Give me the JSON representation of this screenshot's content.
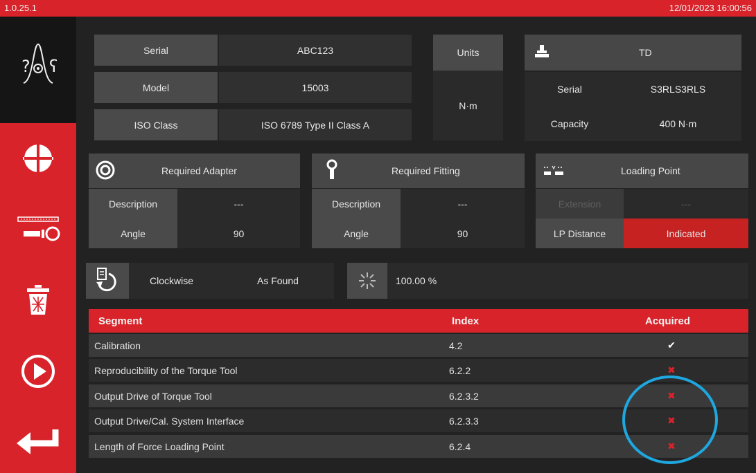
{
  "status_bar": {
    "version": "1.0.25.1",
    "datetime": "12/01/2023 16:00:56"
  },
  "device": {
    "serial_label": "Serial",
    "serial_value": "ABC123",
    "model_label": "Model",
    "model_value": "15003",
    "iso_label": "ISO Class",
    "iso_value": "ISO 6789 Type II Class A"
  },
  "units": {
    "label": "Units",
    "value": "N·m"
  },
  "transducer": {
    "title": "TD",
    "serial_label": "Serial",
    "serial_value": "S3RLS3RLS",
    "capacity_label": "Capacity",
    "capacity_value": "400 N·m"
  },
  "adapter": {
    "title": "Required Adapter",
    "desc_label": "Description",
    "desc_value": "---",
    "angle_label": "Angle",
    "angle_value": "90"
  },
  "fitting": {
    "title": "Required Fitting",
    "desc_label": "Description",
    "desc_value": "---",
    "angle_label": "Angle",
    "angle_value": "90"
  },
  "loading_point": {
    "title": "Loading Point",
    "extension_label": "Extension",
    "extension_value": "---",
    "lp_label": "LP Distance",
    "lp_value": "Indicated"
  },
  "direction": {
    "rotation": "Clockwise",
    "mode": "As Found"
  },
  "percent": {
    "value": "100.00 %"
  },
  "table": {
    "headers": [
      "Segment",
      "Index",
      "Acquired"
    ],
    "rows": [
      {
        "segment": "Calibration",
        "index": "4.2",
        "acquired": "✔"
      },
      {
        "segment": "Reproducibility of the Torque Tool",
        "index": "6.2.2",
        "acquired": "✖"
      },
      {
        "segment": "Output Drive of Torque Tool",
        "index": "6.2.3.2",
        "acquired": "✖"
      },
      {
        "segment": "Output Drive/Cal. System Interface",
        "index": "6.2.3.3",
        "acquired": "✖"
      },
      {
        "segment": "Length of Force Loading Point",
        "index": "6.2.4",
        "acquired": "✖"
      }
    ]
  },
  "colors": {
    "brand_red": "#d8232a",
    "highlight_ring": "#1ea7e0",
    "not_acquired": "#d8232a"
  }
}
